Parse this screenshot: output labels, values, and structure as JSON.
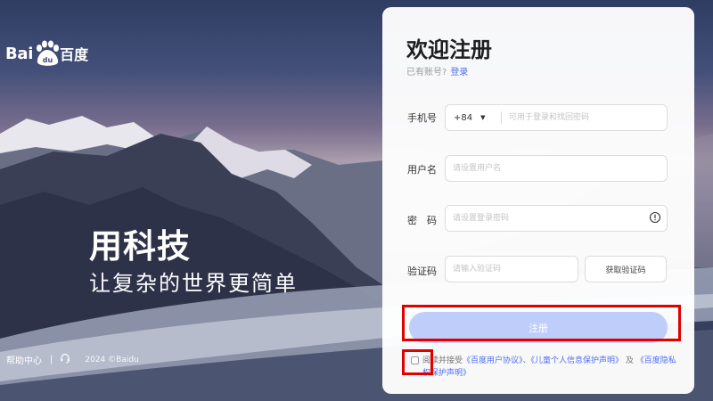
{
  "logo": {
    "text_left": "Bai",
    "paw_text": "du",
    "text_right": "百度"
  },
  "slogan": {
    "main": "用科技",
    "sub": "让复杂的世界更简单"
  },
  "footer": {
    "help": "帮助中心",
    "separator": "|",
    "copyright": "2024 ©Baidu"
  },
  "register": {
    "title": "欢迎注册",
    "have_account": "已有账号?",
    "login_link": "登录",
    "phone": {
      "label": "手机号",
      "country_code": "+84",
      "placeholder": "可用于登录和找回密码"
    },
    "username": {
      "label": "用户名",
      "placeholder": "请设置用户名"
    },
    "password": {
      "label": "密　码",
      "placeholder": "请设置登录密码"
    },
    "verify": {
      "label": "验证码",
      "placeholder": "请输入验证码",
      "button": "获取验证码"
    },
    "submit": "注册",
    "agreement": {
      "prefix": "阅读并接受",
      "link1": "《百度用户协议》",
      "sep1": "、",
      "link2": "《儿童个人信息保护声明》",
      "sep2": " 及 ",
      "link3": "《百度隐私权保护声明》"
    }
  },
  "colors": {
    "accent": "#4e6ef2",
    "button_disabled": "#bfcdfb",
    "highlight": "#e00000"
  }
}
